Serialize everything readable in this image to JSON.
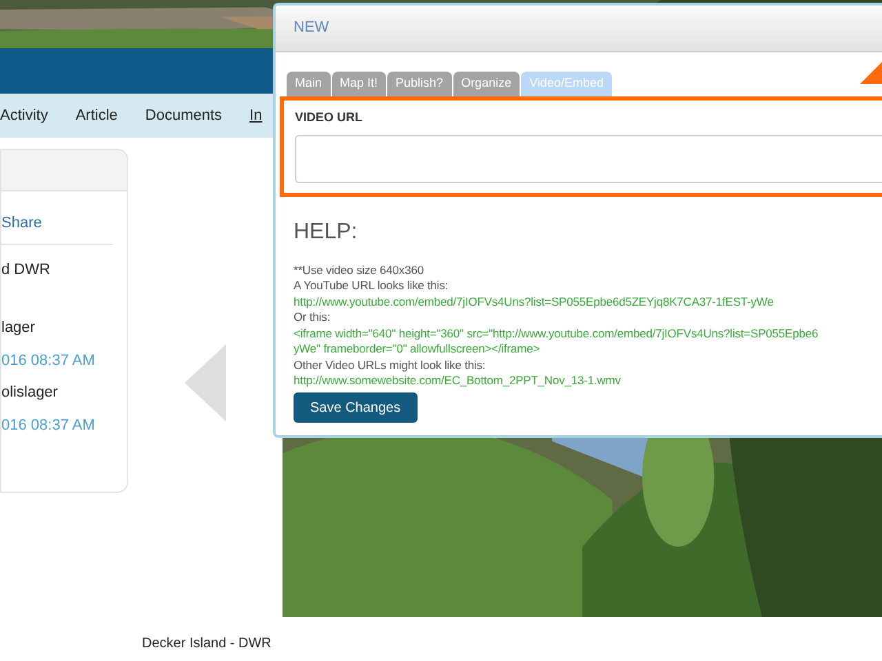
{
  "nav": {
    "items": [
      {
        "label": "Activity",
        "selected": false
      },
      {
        "label": "Article",
        "selected": false
      },
      {
        "label": "Documents",
        "selected": false
      },
      {
        "label": "In",
        "selected": true
      }
    ]
  },
  "side_card": {
    "share_link": "Share",
    "lines": [
      {
        "kind": "text",
        "text": "d DWR"
      },
      {
        "kind": "text",
        "text": "lager"
      },
      {
        "kind": "date",
        "text": "016 08:37 AM"
      },
      {
        "kind": "text",
        "text": "olislager"
      },
      {
        "kind": "date",
        "text": "016 08:37 AM"
      }
    ]
  },
  "photo": {
    "kind": "picture",
    "caption": "Decker Island - DWR"
  },
  "dialog": {
    "title": "NEW",
    "tabs": [
      {
        "label": "Main",
        "selected": false
      },
      {
        "label": "Map It!",
        "selected": false
      },
      {
        "label": "Publish?",
        "selected": false
      },
      {
        "label": "Organize",
        "selected": false
      },
      {
        "label": "Video/Embed",
        "selected": true
      }
    ],
    "video_url": {
      "label": "VIDEO URL",
      "highlighted": true
    },
    "help": {
      "title": "HELP:",
      "lines": [
        {
          "kind": "note",
          "text": "**Use video size 640x360"
        },
        {
          "kind": "note",
          "text": "A YouTube URL looks like this:"
        },
        {
          "kind": "example",
          "text": "http://www.youtube.com/embed/7jIOFVs4Uns?list=SP055Epbe6d5ZEYjq8K7CA37-1fEST-yWe"
        },
        {
          "kind": "note",
          "text": "Or this:"
        },
        {
          "kind": "example",
          "text": "<iframe width=\"640\" height=\"360\" src=\"http://www.youtube.com/embed/7jIOFVs4Uns?list=SP055Epbe6"
        },
        {
          "kind": "example",
          "text": "yWe\" frameborder=\"0\" allowfullscreen></iframe>"
        },
        {
          "kind": "note",
          "text": "Other Video URLs might look like this:"
        },
        {
          "kind": "example",
          "text": "http://www.somewebsite.com/EC_Bottom_2PPT_Nov_13-1.wmv"
        }
      ]
    },
    "save_button": "Save Changes"
  }
}
